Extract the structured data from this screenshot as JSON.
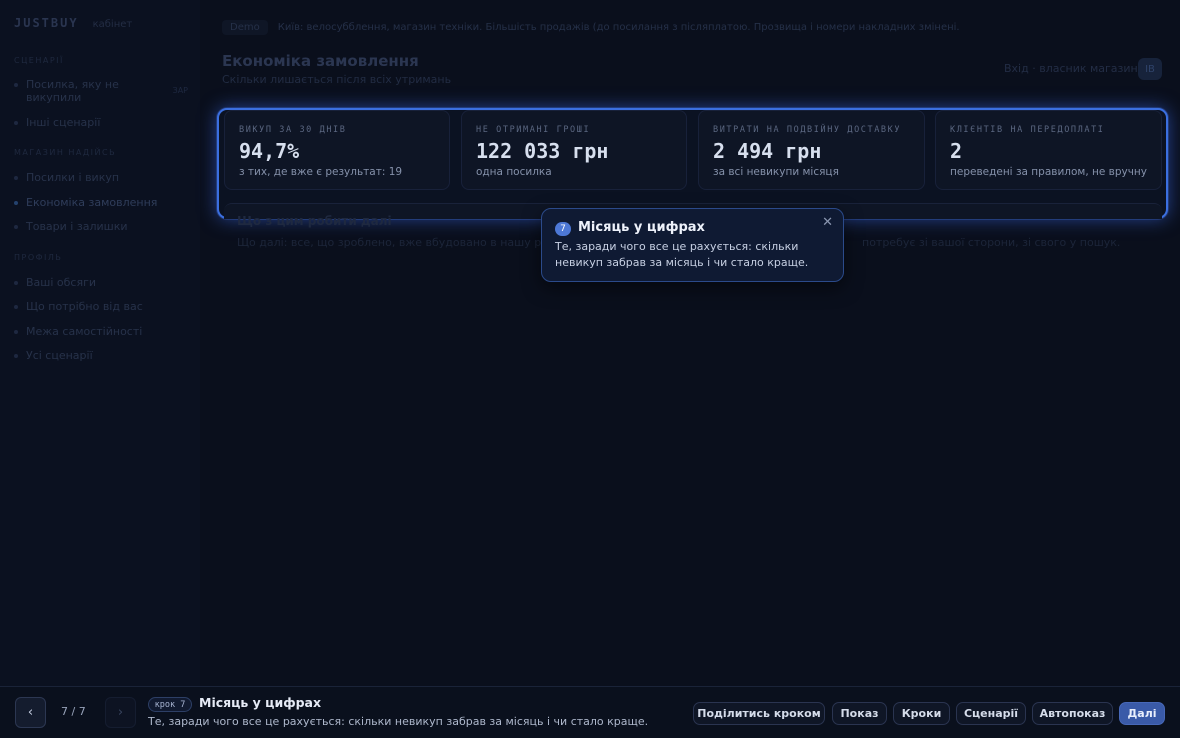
{
  "sidebar": {
    "brand": "JUSTBUY",
    "brand_sub": "кабінет",
    "groups": [
      "СЦЕНАРІЇ",
      "МАГАЗИН НАДІЙСЬ",
      "ПРОФІЛЬ"
    ],
    "items": [
      {
        "label": "Посилка, яку не викупили",
        "badge": "ЗАР"
      },
      {
        "label": "Інші сценарії"
      },
      {
        "label": "Посилки і викуп"
      },
      {
        "label": "Економіка замовлення"
      },
      {
        "label": "Товари і залишки"
      },
      {
        "label": "Ваші обсяги"
      },
      {
        "label": "Що потрібно від вас"
      },
      {
        "label": "Межа самостійності"
      },
      {
        "label": "Усі сценарії"
      }
    ]
  },
  "header": {
    "breadcrumb_home": "Demo",
    "breadcrumb_text": "Київ: велосубблення, магазин техніки. Більшість продажів (до посилання з післяплатою. Прозвища і номери накладних змінені.",
    "title": "Економіка замовлення",
    "subtitle": "Скільки лишається після всіх утримань",
    "store_link": "Вхід · власник магазину",
    "store_btn": "ІВ"
  },
  "kpis": [
    {
      "label": "ВИКУП ЗА 30 ДНІВ",
      "value": "94,7%",
      "note": "з тих, де вже є результат: 19"
    },
    {
      "label": "НЕ ОТРИМАНІ ГРОШІ",
      "value": "122 033 грн",
      "note": "одна посилка"
    },
    {
      "label": "ВИТРАТИ НА ПОДВІЙНУ ДОСТАВКУ",
      "value": "2 494 грн",
      "note": "за всі невикупи місяця"
    },
    {
      "label": "КЛІЄНТІВ НА ПЕРЕДОПЛАТІ",
      "value": "2",
      "note": "переведені за правилом, не вручну"
    }
  ],
  "dim_section": {
    "heading": "Що з цим робити далі",
    "text_left": "Що далі: все, що зроблено, вже вбудовано в нашу роботу...",
    "text_right": "потребує зі вашої сторони, зі свого у пошук."
  },
  "tooltip": {
    "step": "7",
    "title": "Місяць у цифрах",
    "body": "Те, заради чого все це рахується: скільки невикуп забрав за місяць і чи стало краще."
  },
  "bottom": {
    "prev_icon": "‹",
    "next_icon": "›",
    "counter": "7 / 7",
    "step_pill": "крок 7",
    "title": "Місяць у цифрах",
    "desc": "Те, заради чого все це рахується: скільки невикуп забрав за місяць і чи стало краще.",
    "buttons": {
      "share": "Поділитись кроком",
      "show": "Показ",
      "steps": "Кроки",
      "scenarios": "Сценарії",
      "autoshow": "Автопоказ",
      "next": "Далі"
    }
  },
  "colors": {
    "highlight": "#3b6fe0",
    "primary": "#3a5aa8",
    "tooltip_bg": "#0f1a33"
  }
}
